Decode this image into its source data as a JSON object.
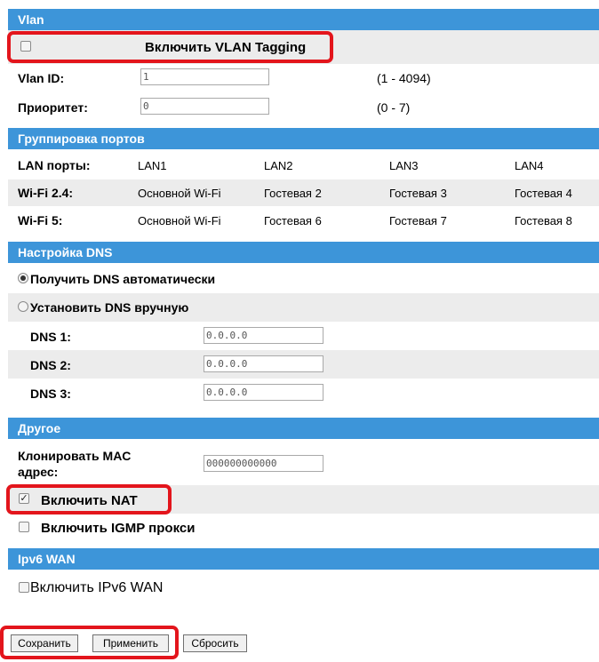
{
  "vlan": {
    "header": "Vlan",
    "enable_tagging": {
      "label": "Включить VLAN Tagging",
      "checked": false
    },
    "vlan_id": {
      "label": "Vlan ID:",
      "value": "1",
      "range": "(1 - 4094)"
    },
    "priority": {
      "label": "Приоритет:",
      "value": "0",
      "range": "(0 - 7)"
    }
  },
  "port_grouping": {
    "header": "Группировка портов",
    "rows": [
      {
        "label": "LAN порты:",
        "cells": [
          "LAN1",
          "LAN2",
          "LAN3",
          "LAN4"
        ]
      },
      {
        "label": "Wi-Fi 2.4:",
        "cells": [
          "Основной Wi-Fi",
          "Гостевая 2",
          "Гостевая 3",
          "Гостевая 4"
        ]
      },
      {
        "label": "Wi-Fi 5:",
        "cells": [
          "Основной Wi-Fi",
          "Гостевая 6",
          "Гостевая 7",
          "Гостевая 8"
        ]
      }
    ]
  },
  "dns": {
    "header": "Настройка DNS",
    "auto": {
      "label": "Получить DNS автоматически",
      "selected": true
    },
    "manual": {
      "label": "Установить DNS вручную",
      "selected": false
    },
    "dns1": {
      "label": "DNS 1:",
      "value": "0.0.0.0"
    },
    "dns2": {
      "label": "DNS 2:",
      "value": "0.0.0.0"
    },
    "dns3": {
      "label": "DNS 3:",
      "value": "0.0.0.0"
    }
  },
  "other": {
    "header": "Другое",
    "clone_mac": {
      "label_line1": "Клонировать MAC",
      "label_line2": "адрес:",
      "value": "000000000000"
    },
    "enable_nat": {
      "label": "Включить NAT",
      "checked": true
    },
    "enable_igmp": {
      "label": "Включить IGMP прокси",
      "checked": false
    }
  },
  "ipv6": {
    "header": "Ipv6 WAN",
    "enable": {
      "label": "Включить IPv6 WAN",
      "checked": false
    }
  },
  "buttons": {
    "save": "Сохранить",
    "apply": "Применить",
    "reset": "Сбросить"
  },
  "colors": {
    "header_bg": "#3d95d9",
    "alt_row_bg": "#ececec",
    "highlight": "#e3151c"
  }
}
